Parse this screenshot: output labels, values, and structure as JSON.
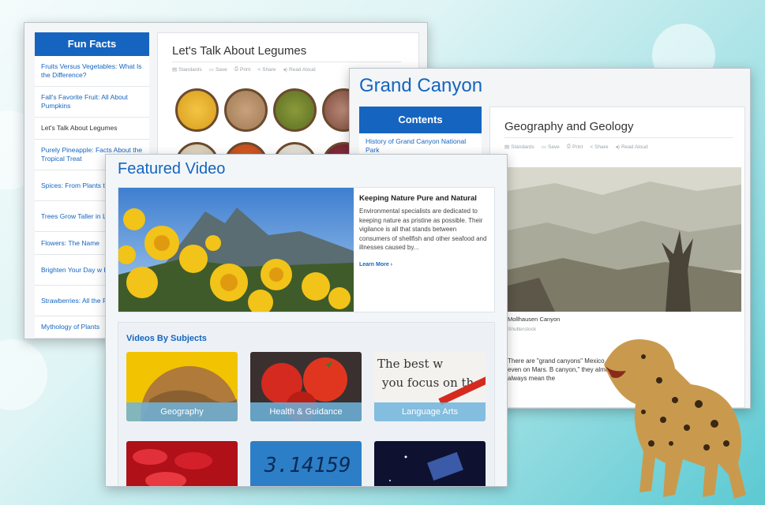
{
  "fun_facts": {
    "heading": "Fun Facts",
    "items": [
      {
        "label": "Fruits Versus Vegetables: What Is the Difference?",
        "active": false
      },
      {
        "label": "Fall's Favorite Fruit: All About Pumpkins",
        "active": false
      },
      {
        "label": "Let's Talk About Legumes",
        "active": true
      },
      {
        "label": "Purely Pineapple: Facts About the Tropical Treat",
        "active": false
      },
      {
        "label": "Spices: From Plants to Kitchen",
        "active": false
      },
      {
        "label": "Trees Grow Taller in Landscape",
        "active": false
      },
      {
        "label": "Flowers: The Name",
        "active": false
      },
      {
        "label": "Brighten Your Day w Facts",
        "active": false
      },
      {
        "label": "Strawberries: All the Facts",
        "active": false
      },
      {
        "label": "Mythology of Plants",
        "active": false
      }
    ],
    "article_title": "Let's Talk About Legumes"
  },
  "toolbar": {
    "standards": "Standards",
    "save": "Save",
    "print": "Print",
    "share": "Share",
    "read_aloud": "Read Aloud"
  },
  "grand_canyon": {
    "title": "Grand Canyon",
    "contents_heading": "Contents",
    "contents_items": [
      "History of Grand Canyon National Park"
    ],
    "article_title": "Geography and Geology",
    "caption": "Mollhausen Canyon",
    "credit": "Shutterstock",
    "body": "There are \"grand canyons\" Mexico, and even on Mars. B canyon,\" they almost always mean the"
  },
  "featured": {
    "title": "Featured Video",
    "video_title": "Keeping Nature Pure and Natural",
    "video_text": "Environmental specialists are dedicated to keeping nature as pristine as possible. Their vigilance is all that stands between consumers of shellfish and other seafood and illnesses caused by...",
    "learn_more": "Learn More ›",
    "subjects_heading": "Videos By Subjects",
    "subjects": [
      "Geography",
      "Health & Guidance",
      "Language Arts"
    ],
    "tile_texts": {
      "lang1": "The best w",
      "lang2": "you focus on th",
      "math": "3.14159"
    }
  },
  "colors": {
    "brand": "#1565c0"
  }
}
